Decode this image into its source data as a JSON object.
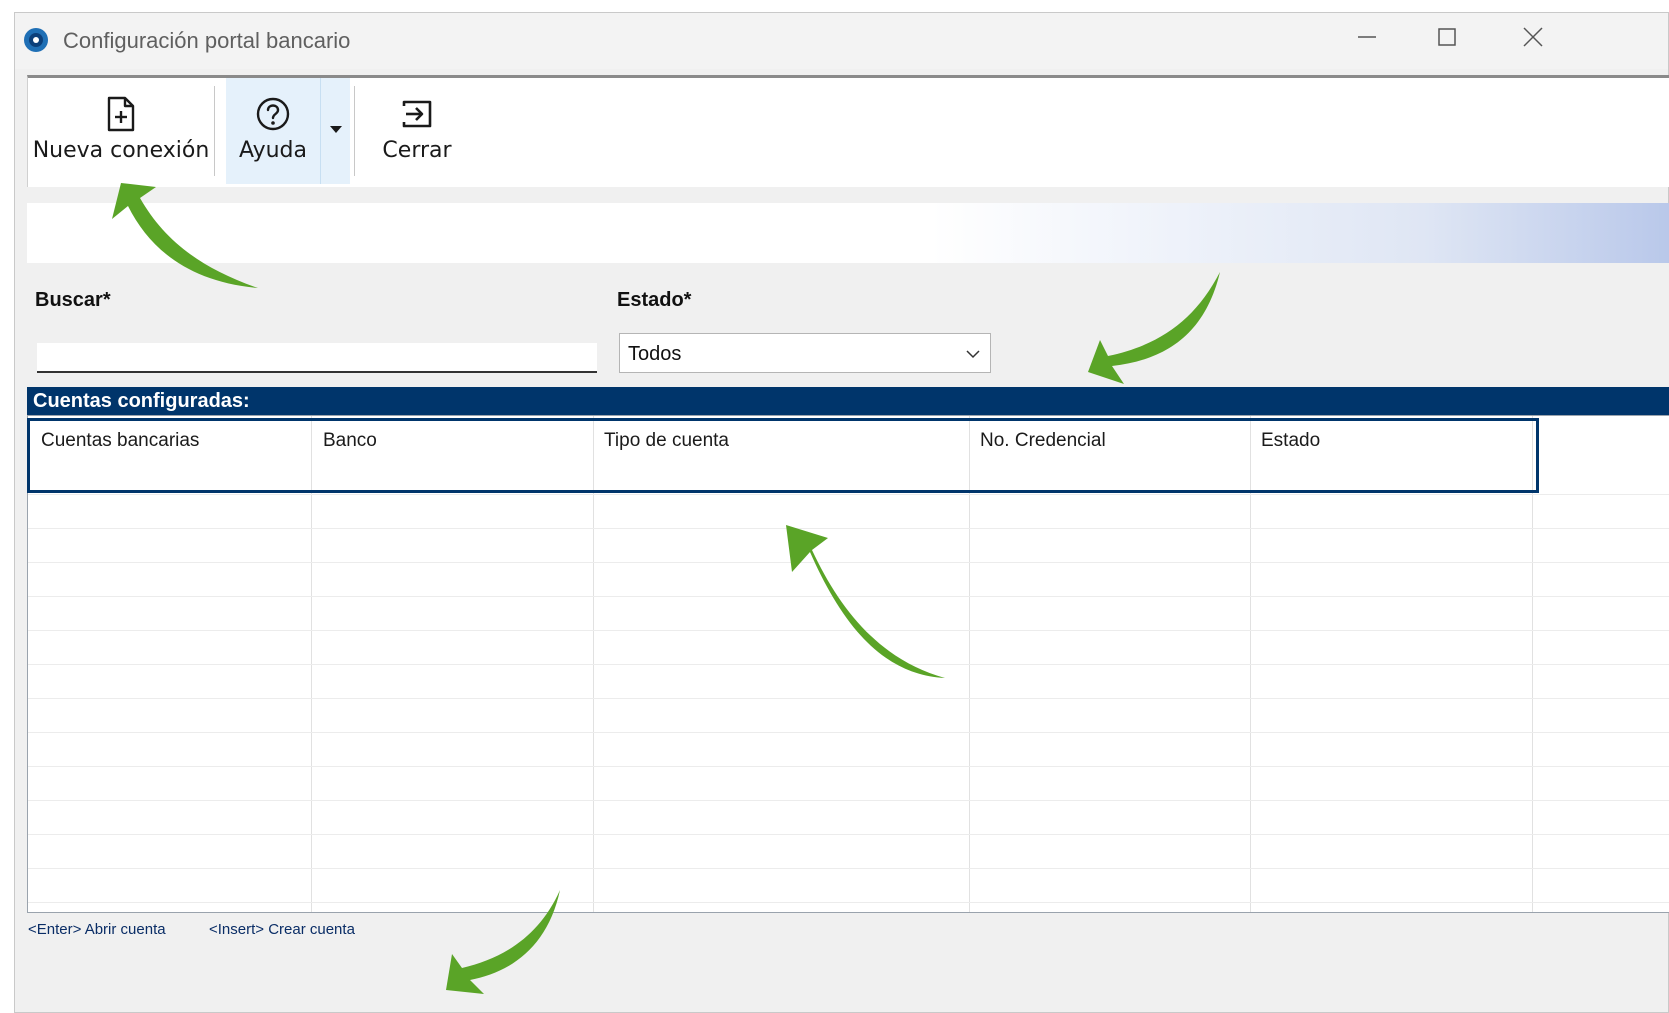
{
  "window": {
    "title": "Configuración portal bancario"
  },
  "toolbar": {
    "new_connection_label": "Nueva conexión",
    "help_label": "Ayuda",
    "close_label": "Cerrar"
  },
  "filters": {
    "search_label": "Buscar*",
    "search_value": "",
    "status_label": "Estado*",
    "status_value": "Todos"
  },
  "accounts": {
    "section_title": "Cuentas configuradas:",
    "columns": [
      "Cuentas bancarias",
      "Banco",
      "Tipo de cuenta",
      "No. Credencial",
      "Estado"
    ],
    "rows": []
  },
  "status_bar": {
    "hint_open": "<Enter> Abrir cuenta",
    "hint_create": "<Insert> Crear cuenta"
  },
  "colors": {
    "section_header": "#00356b",
    "annotation_arrow": "#5aa427"
  },
  "icons": [
    "app-logo-icon",
    "minimize-icon",
    "maximize-icon",
    "close-icon",
    "file-plus-icon",
    "help-circle-icon",
    "dropdown-arrow-icon",
    "exit-icon",
    "chevron-down-icon"
  ]
}
